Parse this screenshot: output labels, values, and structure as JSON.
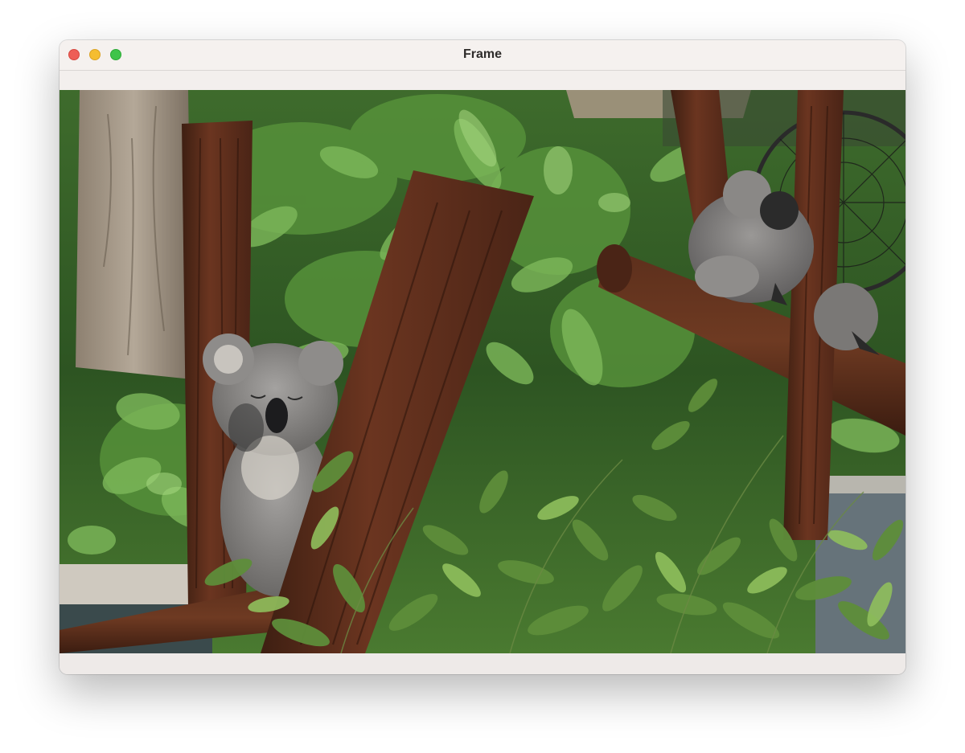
{
  "window": {
    "title": "Frame"
  },
  "photo": {
    "subject": "koalas-on-wooden-perches"
  },
  "colors": {
    "close": "#ee5e57",
    "minimize": "#f5bd30",
    "maximize": "#3fc44a",
    "titlebar": "#f5f1ef"
  }
}
